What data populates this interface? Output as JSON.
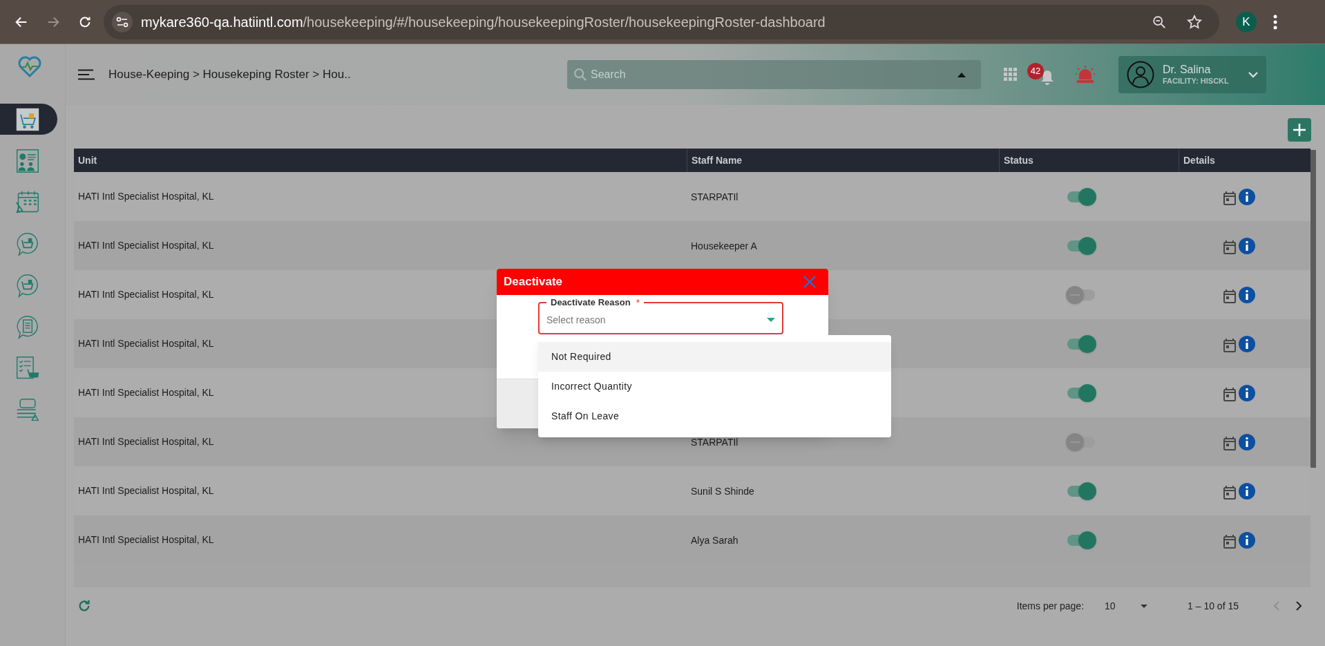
{
  "browser": {
    "url_host": "mykare360-qa.hatiintl.com",
    "url_path": "/housekeeping/#/housekeeping/housekeepingRoster/housekeepingRoster-dashboard",
    "profile_initial": "K"
  },
  "header": {
    "breadcrumb": "House-Keeping > Housekeping Roster > Hou..",
    "search": {
      "placeholder": "Search"
    },
    "notification_count": "42",
    "user": {
      "name": "Dr. Salina",
      "facility": "FACILITY: HISCKL"
    }
  },
  "sidebar": {
    "items": [
      {
        "kind": "cart",
        "selected": true
      },
      {
        "kind": "report",
        "selected": false
      },
      {
        "kind": "calendar",
        "selected": false
      },
      {
        "kind": "bubble",
        "selected": false
      },
      {
        "kind": "bubble",
        "selected": false
      },
      {
        "kind": "checklist-bubble",
        "selected": false
      },
      {
        "kind": "checklist",
        "selected": false
      },
      {
        "kind": "linen",
        "selected": false
      }
    ]
  },
  "table": {
    "columns": [
      "Unit",
      "Staff Name",
      "Status",
      "Details"
    ],
    "rows": [
      {
        "unit": "HATI Intl Specialist Hospital, KL",
        "staff_name": "STARPATIl",
        "active": true
      },
      {
        "unit": "HATI Intl Specialist Hospital, KL",
        "staff_name": "Housekeeper A",
        "active": true
      },
      {
        "unit": "HATI Intl Specialist Hospital, KL",
        "active": false
      },
      {
        "unit": "HATI Intl Specialist Hospital, KL",
        "active": true
      },
      {
        "unit": "HATI Intl Specialist Hospital, KL",
        "active": true
      },
      {
        "unit": "HATI Intl Specialist Hospital, KL",
        "staff_name": "STARPATIl",
        "active": false
      },
      {
        "unit": "HATI Intl Specialist Hospital, KL",
        "staff_name": "Sunil S Shinde",
        "active": true
      },
      {
        "unit": "HATI Intl Specialist Hospital, KL",
        "staff_name": "Alya Sarah",
        "active": true
      }
    ]
  },
  "pagination": {
    "label": "Items per page:",
    "page_size": "10",
    "range": "1 – 10 of 15"
  },
  "dialog": {
    "title": "Deactivate",
    "field": {
      "label": "Deactivate Reason",
      "required_mark": "*",
      "placeholder": "Select reason"
    },
    "options": [
      {
        "label": "Not Required",
        "highlighted": true
      },
      {
        "label": "Incorrect Quantity",
        "highlighted": false
      },
      {
        "label": "Staff On Leave",
        "highlighted": false
      }
    ]
  }
}
